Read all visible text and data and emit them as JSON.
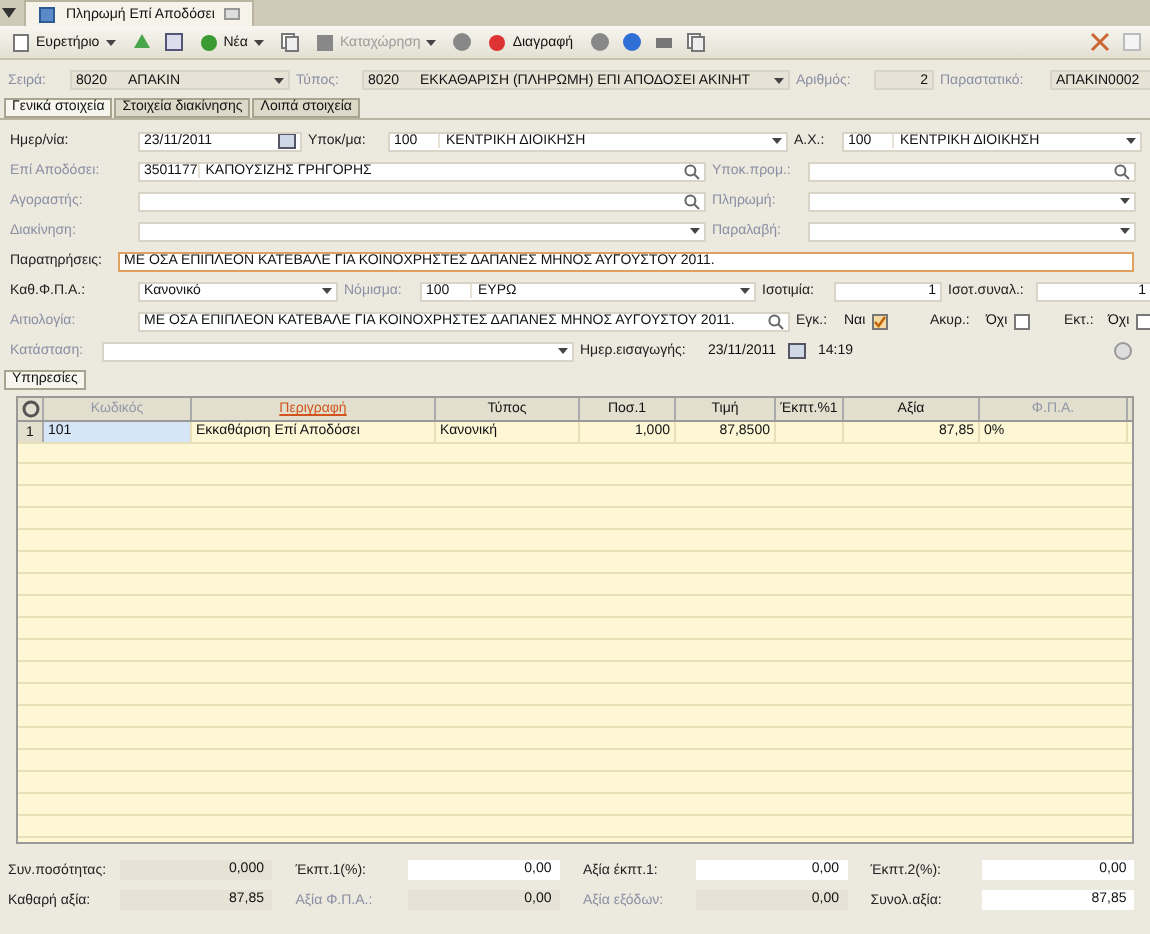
{
  "window_tab": {
    "title": "Πληρωμή Επί Αποδόσει"
  },
  "toolbar": [
    {
      "kind": "menu",
      "label": "Ευρετήριο",
      "disabled": false
    },
    {
      "kind": "icon"
    },
    {
      "kind": "icon"
    },
    {
      "kind": "menu",
      "label": "Νέα",
      "disabled": false
    },
    {
      "kind": "icon"
    },
    {
      "kind": "menu",
      "label": "Καταχώρηση",
      "disabled": true
    },
    {
      "kind": "icon"
    },
    {
      "kind": "plain",
      "label": "Διαγραφή",
      "disabled": false
    },
    {
      "kind": "icon"
    },
    {
      "kind": "icon"
    },
    {
      "kind": "icon"
    },
    {
      "kind": "icon"
    }
  ],
  "header": [
    {
      "label": "Σειρά:",
      "code": "8020",
      "value": "ΑΠΑΚΙΝ",
      "kind": "combo"
    },
    {
      "label": "Τύπος:",
      "code": "8020",
      "value": "ΕΚΚΑΘΑΡΙΣΗ (ΠΛΗΡΩΜΗ) ΕΠΙ ΑΠΟΔΟΣΕΙ ΑΚΙΝΗΤ",
      "kind": "combo"
    },
    {
      "label": "Αριθμός:",
      "value": "2",
      "kind": "num"
    },
    {
      "label": "Παραστατικό:",
      "value": "ΑΠΑΚΙΝ0002",
      "kind": "text"
    }
  ],
  "tabs": [
    {
      "label": "Γενικά στοιχεία",
      "selected": true
    },
    {
      "label": "Στοιχεία διακίνησης",
      "selected": false
    },
    {
      "label": "Λοιπά στοιχεία",
      "selected": false
    }
  ],
  "form_rows": [
    [
      {
        "label": "Ημερ/νία:",
        "disabled": false,
        "kind": "date",
        "value": "23/11/2011"
      },
      {
        "label": "Υποκ/μα:",
        "disabled": false,
        "kind": "combo",
        "code": "100",
        "value": "ΚΕΝΤΡΙΚΗ ΔΙΟΙΚΗΣΗ"
      },
      {
        "label": "Α.Χ.:",
        "disabled": false,
        "kind": "combo",
        "code": "100",
        "value": "ΚΕΝΤΡΙΚΗ ΔΙΟΙΚΗΣΗ"
      }
    ],
    [
      {
        "label": "Επί Αποδόσει:",
        "disabled": true,
        "kind": "lookup",
        "code": "3501177",
        "value": "ΚΑΠΟΥΣΙΖΗΣ ΓΡΗΓΟΡΗΣ"
      },
      {
        "label": "Υποκ.προμ.:",
        "disabled": true,
        "kind": "lookup"
      }
    ],
    [
      {
        "label": "Αγοραστής:",
        "disabled": true,
        "kind": "lookup"
      },
      {
        "label": "Πληρωμή:",
        "disabled": true,
        "kind": "combo"
      }
    ],
    [
      {
        "label": "Διακίνηση:",
        "disabled": true,
        "kind": "combo"
      },
      {
        "label": "Παραλαβή:",
        "disabled": true,
        "kind": "combo"
      }
    ],
    [
      {
        "label": "Παρατηρήσεις:",
        "disabled": false,
        "kind": "memo",
        "value": "ΜΕ ΟΣΑ ΕΠΙΠΛΕΟΝ ΚΑΤΕΒΑΛΕ ΓΙΑ ΚΟΙΝΟΧΡΗΣΤΕΣ ΔΑΠΑΝΕΣ ΜΗΝΟΣ ΑΥΓΟΥΣΤΟΥ 2011."
      }
    ],
    [
      {
        "label": "Καθ.Φ.Π.Α.:",
        "disabled": false,
        "kind": "combo",
        "value": "Κανονικό"
      },
      {
        "label": "Νόμισμα:",
        "disabled": true,
        "kind": "combo",
        "code": "100",
        "value": "ΕΥΡΩ"
      },
      {
        "label": "Ισοτιμία:",
        "disabled": false,
        "kind": "num",
        "value": "1"
      },
      {
        "label": "Ισοτ.συναλ.:",
        "disabled": false,
        "kind": "num",
        "value": "1"
      }
    ],
    [
      {
        "label": "Αιτιολογία:",
        "disabled": true,
        "kind": "lookup",
        "value": "ΜΕ ΟΣΑ ΕΠΙΠΛΕΟΝ ΚΑΤΕΒΑΛΕ ΓΙΑ ΚΟΙΝΟΧΡΗΣΤΕΣ ΔΑΠΑΝΕΣ ΜΗΝΟΣ ΑΥΓΟΥΣΤΟΥ 2011."
      },
      {
        "label": "Εγκ.:",
        "disabled": false,
        "kind": "check",
        "value": "Ναι",
        "checked": true
      },
      {
        "label": "Ακυρ.:",
        "disabled": false,
        "kind": "check",
        "value": "Όχι",
        "checked": false
      },
      {
        "label": "Εκτ.:",
        "disabled": false,
        "kind": "check",
        "value": "Όχι",
        "checked": false
      }
    ],
    [
      {
        "label": "Κατάσταση:",
        "disabled": true,
        "kind": "combo"
      },
      {
        "label": "Ημερ.εισαγωγής:",
        "disabled": false,
        "kind": "stamp",
        "value": "23/11/2011",
        "time": "14:19"
      }
    ]
  ],
  "sub_tab": {
    "label": "Υπηρεσίες"
  },
  "grid": {
    "columns": [
      {
        "label": "Κωδικός"
      },
      {
        "label": "Περιγραφή"
      },
      {
        "label": "Τύπος"
      },
      {
        "label": "Ποσ.1"
      },
      {
        "label": "Τιμή"
      },
      {
        "label": "Έκπτ.%1"
      },
      {
        "label": "Αξία"
      },
      {
        "label": "Φ.Π.Α."
      }
    ],
    "rows": [
      {
        "number": "1",
        "cells": [
          "101",
          "Εκκαθάριση Επί Αποδόσει",
          "Κανονική",
          "1,000",
          "87,8500",
          "",
          "87,85",
          "0%"
        ]
      }
    ]
  },
  "totals": [
    [
      {
        "label": "Συν.ποσότητας:",
        "disabled": false,
        "value": "0,000",
        "editable": false
      },
      {
        "label": "Έκπτ.1(%):",
        "disabled": false,
        "value": "0,00",
        "editable": true
      },
      {
        "label": "Αξία έκπτ.1:",
        "disabled": false,
        "value": "0,00",
        "editable": true
      },
      {
        "label": "Έκπτ.2(%):",
        "disabled": false,
        "value": "0,00",
        "editable": true
      }
    ],
    [
      {
        "label": "Καθαρή αξία:",
        "disabled": false,
        "value": "87,85",
        "editable": false
      },
      {
        "label": "Αξία Φ.Π.Α.:",
        "disabled": true,
        "value": "0,00",
        "editable": false
      },
      {
        "label": "Αξία εξόδων:",
        "disabled": true,
        "value": "0,00",
        "editable": false
      },
      {
        "label": "Συνολ.αξία:",
        "disabled": false,
        "value": "87,85",
        "editable": true
      }
    ]
  ]
}
